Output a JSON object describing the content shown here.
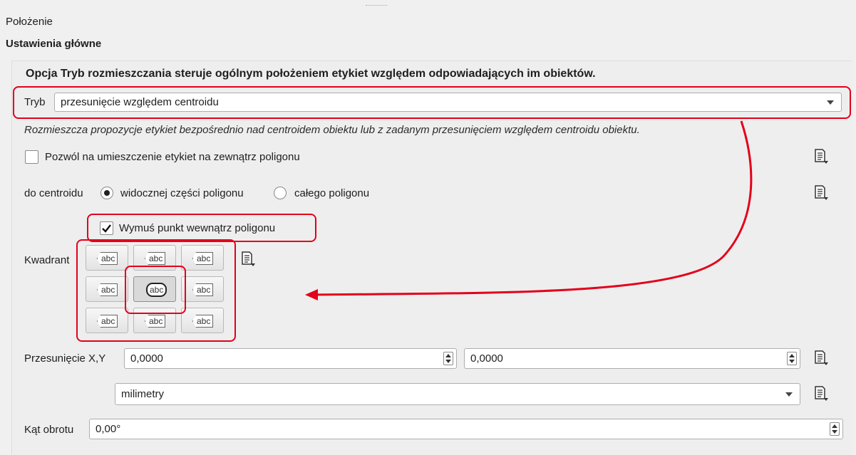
{
  "section": {
    "title": "Położenie"
  },
  "group": {
    "title": "Ustawienia główne"
  },
  "description": "Opcja Tryb rozmieszczania steruje ogólnym położeniem etykiet względem odpowiadających im obiektów.",
  "mode": {
    "label": "Tryb",
    "value": "przesunięcie względem centroidu",
    "hint": "Rozmieszcza propozycje etykiet bezpośrednio nad centroidem obiektu lub z zadanym przesunięciem względem centroidu obiektu."
  },
  "allow_outside": {
    "label": "Pozwól na umieszczenie etykiet na zewnątrz poligonu",
    "checked": false
  },
  "centroid": {
    "label": "do centroidu",
    "options": [
      {
        "label": "widocznej części poligonu",
        "selected": true
      },
      {
        "label": "całego poligonu",
        "selected": false
      }
    ]
  },
  "force_inside": {
    "label": "Wymuś punkt wewnątrz poligonu",
    "checked": true
  },
  "quadrant": {
    "label": "Kwadrant",
    "buttons": [
      "abc",
      "abc",
      "abc",
      "abc",
      "abc",
      "abc",
      "abc",
      "abc",
      "abc"
    ],
    "selected_index": 4
  },
  "offset": {
    "label": "Przesunięcie X,Y",
    "x": "0,0000",
    "y": "0,0000",
    "units": "milimetry"
  },
  "rotation": {
    "label": "Kąt obrotu",
    "value": "0,00°"
  },
  "icons": {
    "data_defined": "data-defined-override-icon"
  },
  "colors": {
    "annotation": "#e3001b",
    "background": "#f0f0f0"
  }
}
